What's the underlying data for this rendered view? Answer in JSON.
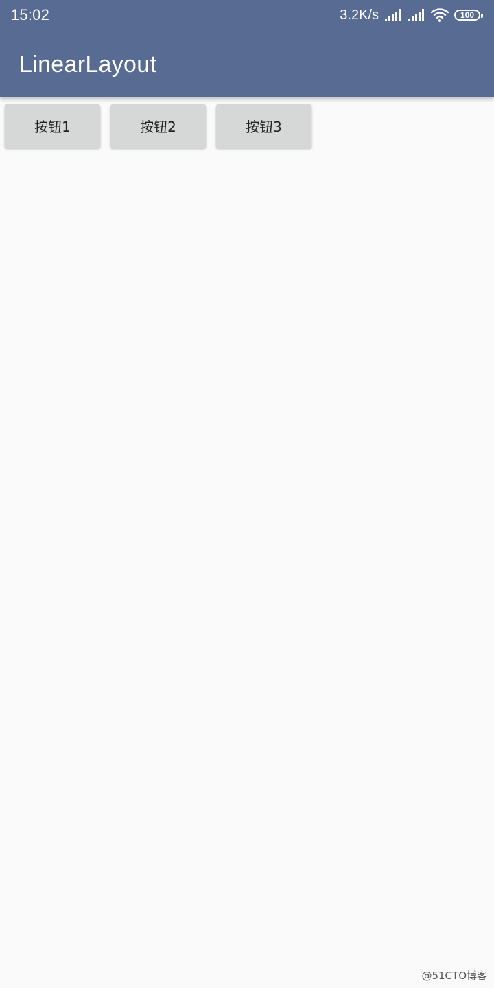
{
  "status_bar": {
    "time": "15:02",
    "net_speed": "3.2K/s",
    "icons": [
      "signal-icon",
      "signal-icon",
      "wifi-icon",
      "battery-icon"
    ],
    "battery_level": "100",
    "color": "#576b93"
  },
  "app_bar": {
    "title": "LinearLayout",
    "color": "#576b93"
  },
  "buttons": [
    {
      "label": "按钮1"
    },
    {
      "label": "按钮2"
    },
    {
      "label": "按钮3"
    }
  ],
  "watermark": "@51CTO博客"
}
